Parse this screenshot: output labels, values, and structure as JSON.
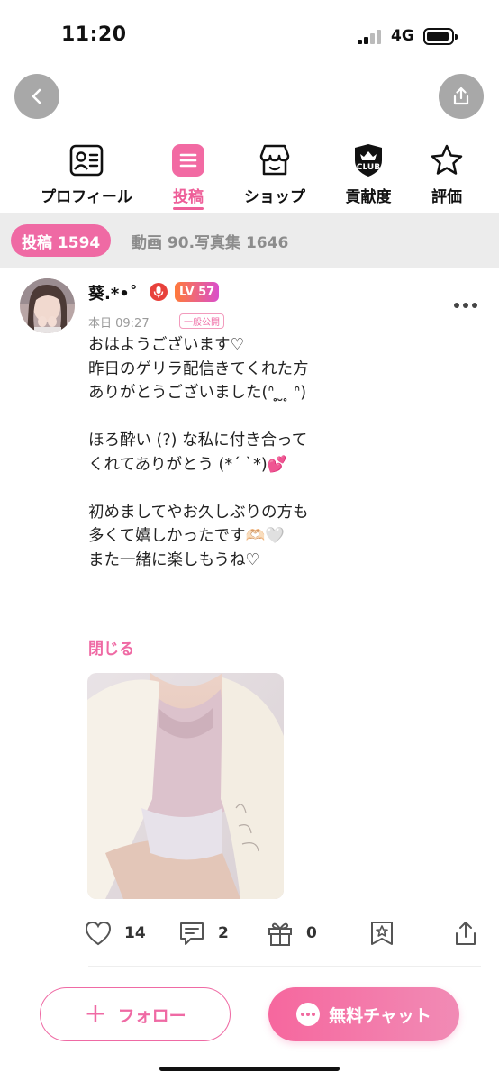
{
  "status_bar": {
    "time": "11:20",
    "network": "4G"
  },
  "tabs": [
    {
      "label": "プロフィール",
      "icon": "profile-card-icon",
      "active": false
    },
    {
      "label": "投稿",
      "icon": "post-list-icon",
      "active": true
    },
    {
      "label": "ショップ",
      "icon": "shop-icon",
      "active": false
    },
    {
      "label": "貢献度",
      "icon": "club-badge-icon",
      "active": false
    },
    {
      "label": "評価",
      "icon": "star-icon",
      "active": false
    }
  ],
  "filter": {
    "active_label": "投稿 1594",
    "other_label": "動画 90.写真集 1646"
  },
  "post": {
    "user_name": "葵.*•˚",
    "level": "LV 57",
    "time": "本日 09:27",
    "visibility": "一般公開",
    "body": "おはようございます♡\n昨日のゲリラ配信きてくれた方\nありがとうございました(ᐢ ̥ ̮ ̥ ᐢ)\n\nほろ酔い (?) な私に付き合って\nくれてありがとう (*´ `*)💕\n\n初めましてやお久しぶりの方も\n多くて嬉しかったです🫶🏻🤍\nまた一緒に楽しもうね♡",
    "close_label": "閉じる",
    "likes": "14",
    "comments": "2",
    "gifts": "0"
  },
  "bottom": {
    "follow_label": "フォロー",
    "follow_plus": "+",
    "chat_label": "無料チャット"
  },
  "colors": {
    "accent": "#ef6aa4",
    "filter_bg": "#ececec",
    "muted": "#8c8c8c"
  }
}
